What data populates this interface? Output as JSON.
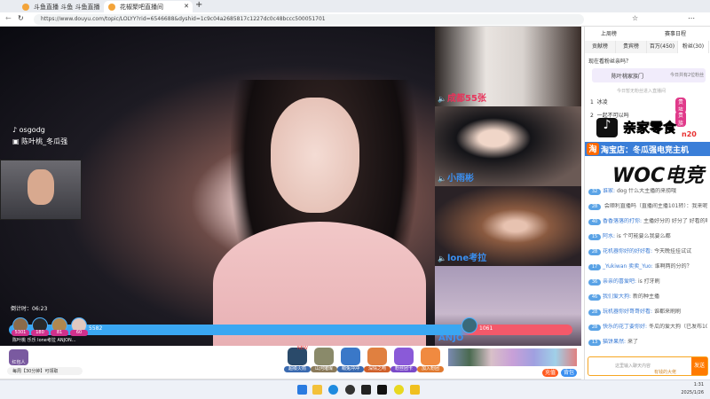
{
  "browser": {
    "tabs": [
      {
        "label": "斗鱼直播 斗鱼 斗鱼直播"
      },
      {
        "label": "花椒聚吧直播间"
      }
    ],
    "new_tab": "+",
    "url": "https://www.douyu.com/topic/LOLYY?rid=6546688&dyshid=1c9c04a2685817c1227dc0c48bccc500051701"
  },
  "video": {
    "tiktok_handle": "osgodg",
    "channel_label": "陈叶桃_冬瓜强",
    "timer": "倒计时：06:23",
    "tiles": [
      {
        "name": "成都55张",
        "color": "#e8325a"
      },
      {
        "name": "小雨彬",
        "color": "#3a8ff0"
      },
      {
        "name": "lone考拉",
        "color": "#3a8ff0"
      },
      {
        "name": "ANJO",
        "color": "#3a8ff0"
      }
    ],
    "pk": {
      "left_score": "5582",
      "right_score": "1061",
      "contributors": [
        {
          "score": "5301"
        },
        {
          "score": "180"
        },
        {
          "score": "81"
        },
        {
          "score": "60"
        }
      ],
      "contributor_names": "陈叶桃 乐乐 lone考拉 ANJON..."
    }
  },
  "ads": {
    "tiktok": "亲家零食",
    "tiktok_badge": "n20",
    "taobao": "淘宝店：冬瓜强电竞主机",
    "woc": "WOC电竞"
  },
  "gifts": {
    "ticker": "每周【30分钟】可领取",
    "left_badge": "红包人",
    "recharge": "充值",
    "backpack": "背包",
    "items": [
      {
        "name": "超级火箭",
        "badge": "NEW"
      },
      {
        "name": "山河璀璨"
      },
      {
        "name": "萌兔冲冲"
      },
      {
        "name": "深情之吻"
      },
      {
        "name": "粉丝团卡"
      },
      {
        "name": "加入粉团"
      }
    ]
  },
  "panel": {
    "top_links": [
      "上周榜",
      "赛事日程"
    ],
    "tabs": [
      "贡献榜",
      "贵宾榜",
      "百万(450)",
      "粉丝(30)"
    ],
    "guard_title": "现在看粉丝亲吗？",
    "fans_club": "陈叶桃家族门",
    "fans_today": "今日共有2位粉丝",
    "empty_hint": "今日暂无粉丝进入直播间",
    "ranks": [
      {
        "n": "1",
        "name": "冰凌",
        "tag": "贵族"
      },
      {
        "n": "2",
        "name": "一起不可以吗",
        "tag": "贵族"
      }
    ],
    "chat": [
      {
        "lv": "32",
        "nick": "谁家:",
        "text": "dog 什么大主播的来捞哦"
      },
      {
        "lv": "28",
        "nick": "",
        "text": "会顺利直播吗（直播间主播101转）：我来呢"
      },
      {
        "lv": "40",
        "nick": "香香落落的打你:",
        "text": "主播好分的 好分了 好看的啊"
      },
      {
        "lv": "15",
        "nick": "阿水:",
        "text": "is 个可能要么我要么都"
      },
      {
        "lv": "28",
        "nick": "花机器你好的好好看:",
        "text": "今天晚挂挂试试"
      },
      {
        "lv": "17",
        "nick": "_Yukiwan 卖卖_Yuo:",
        "text": "谁啊两的分的？"
      },
      {
        "lv": "36",
        "nick": "亲亲的喜爱吧:",
        "text": "is 打牙刷"
      },
      {
        "lv": "46",
        "nick": "我们爱大狗:",
        "text": "新的种主播"
      },
      {
        "lv": "28",
        "nick": "玩机器你好哥哥好看:",
        "text": "谁都来刷刷"
      },
      {
        "lv": "28",
        "nick": "快乐的花丁要你好:",
        "text": "冬瓜的爱大狗（已发布101转）：我也要来"
      },
      {
        "lv": "13",
        "nick": "猫饼果然:",
        "text": "来了"
      }
    ],
    "input_placeholder": "这里输入聊天内容",
    "send": "发送",
    "input_badge": "有钱的大佬"
  },
  "taskbar": {
    "time": "1:31",
    "date": "2025/1/26"
  },
  "colors": {
    "accent": "#ff7a00",
    "pk_blue": "#3aa7f2",
    "pk_red": "#f4596a"
  }
}
